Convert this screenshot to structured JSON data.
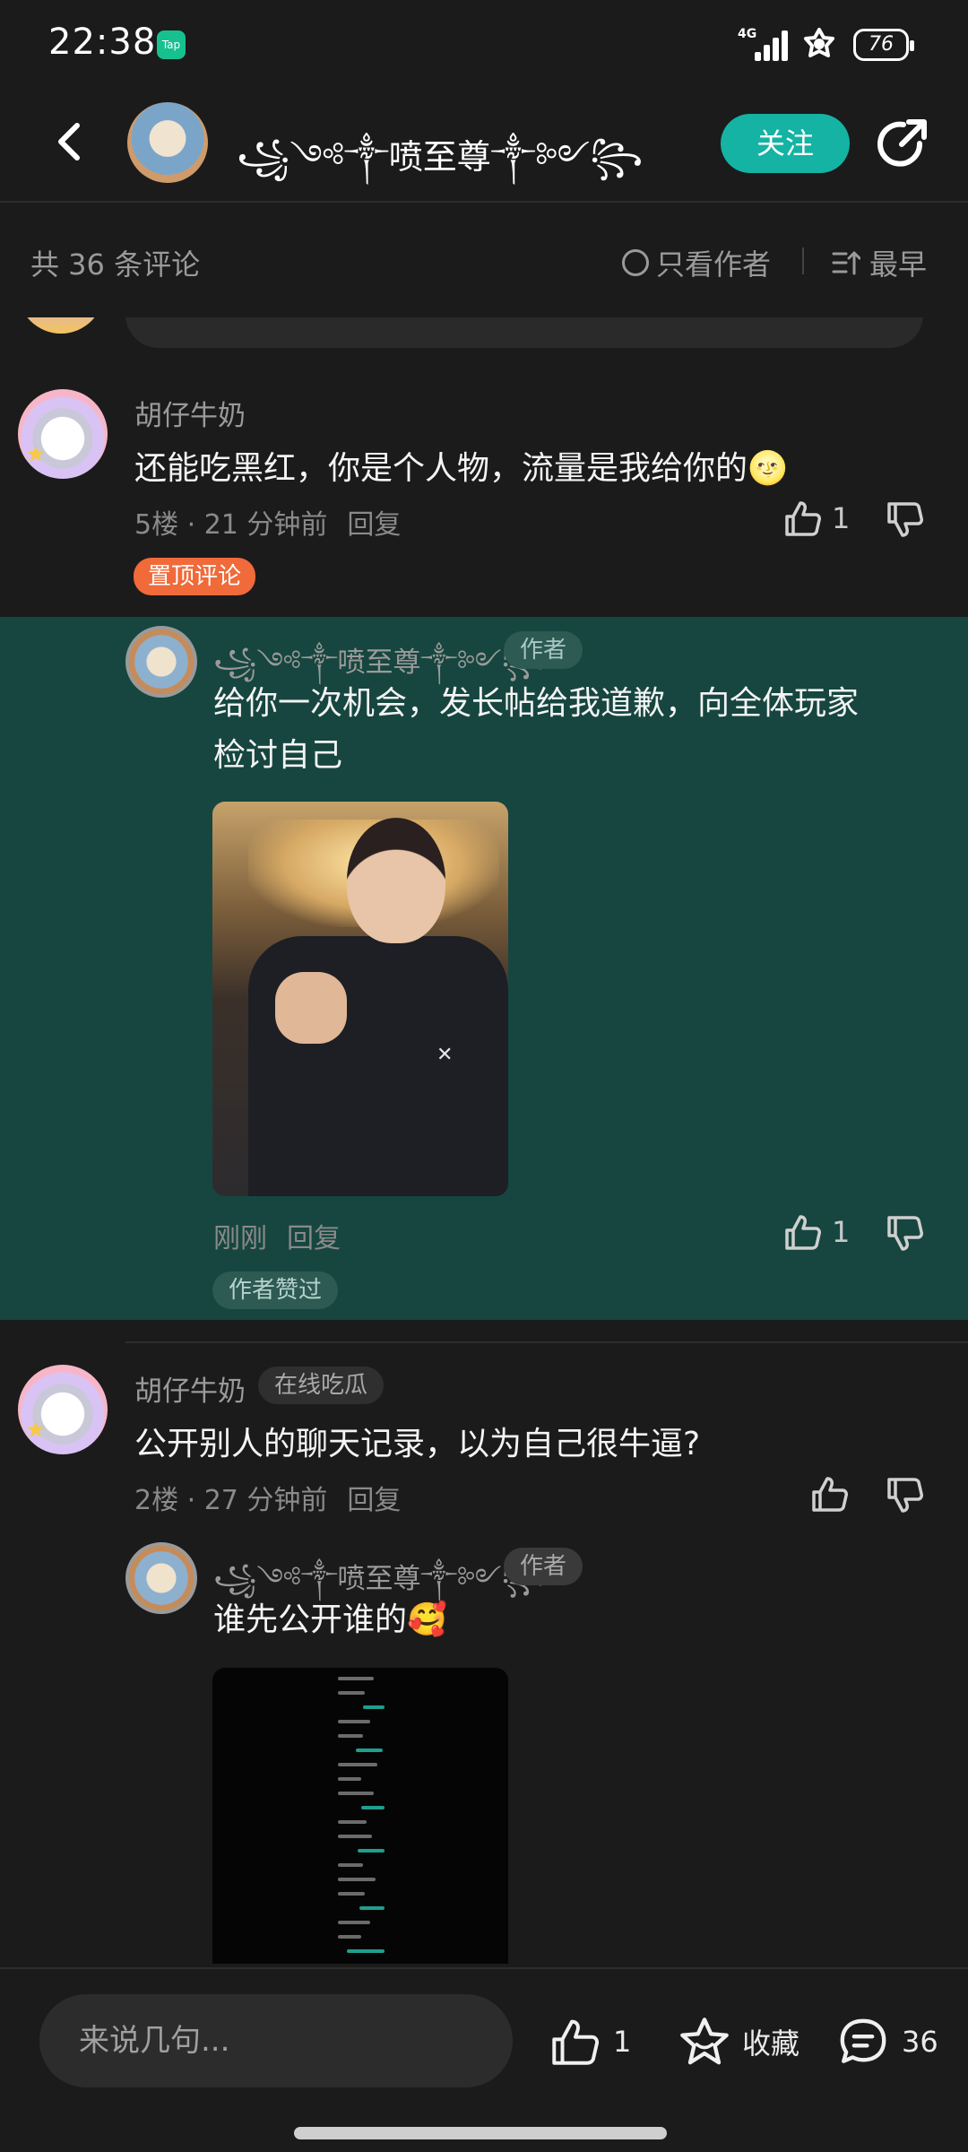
{
  "status_bar": {
    "time": "22:38",
    "app_badge": "Tap",
    "network": "4G",
    "battery": "76"
  },
  "header": {
    "back_icon": "chevron-left-icon",
    "username": "꧁༺༒喷至尊༒༻꧂",
    "follow_label": "关注",
    "share_icon": "share-icon"
  },
  "sort_bar": {
    "count_label": "共 36 条评论",
    "author_only_label": "只看作者",
    "sort_label": "最早"
  },
  "comments": [
    {
      "username": "胡仔牛奶",
      "text": "还能吃黑红，你是个人物，流量是我给你的🌝",
      "meta_floor": "5楼 · 21 分钟前",
      "reply_label": "回复",
      "likes": "1",
      "pinned_tag": "置顶评论",
      "reply": {
        "username": "꧁༺༒喷至尊༒༻꧂",
        "author_tag": "作者",
        "text_line1": "给你一次机会，发长帖给我道歉，向全体玩家",
        "text_line2": "检讨自己",
        "time": "刚刚",
        "reply_label": "回复",
        "likes": "1",
        "liked_tag": "作者赞过"
      }
    },
    {
      "username": "胡仔牛奶",
      "online_tag": "在线吃瓜",
      "text": "公开别人的聊天记录，以为自己很牛逼?",
      "meta_floor": "2楼 · 27 分钟前",
      "reply_label": "回复",
      "reply": {
        "username": "꧁༺༒喷至尊༒༻꧂",
        "author_tag": "作者",
        "text": "谁先公开谁的🥰"
      }
    }
  ],
  "bottom_bar": {
    "input_placeholder": "来说几句...",
    "likes": "1",
    "favorite_label": "收藏",
    "comment_count": "36"
  },
  "colors": {
    "accent": "#14b3a3",
    "highlight_bg": "#16463f",
    "pinned": "#f06a3a",
    "bg": "#1b1b1b"
  }
}
